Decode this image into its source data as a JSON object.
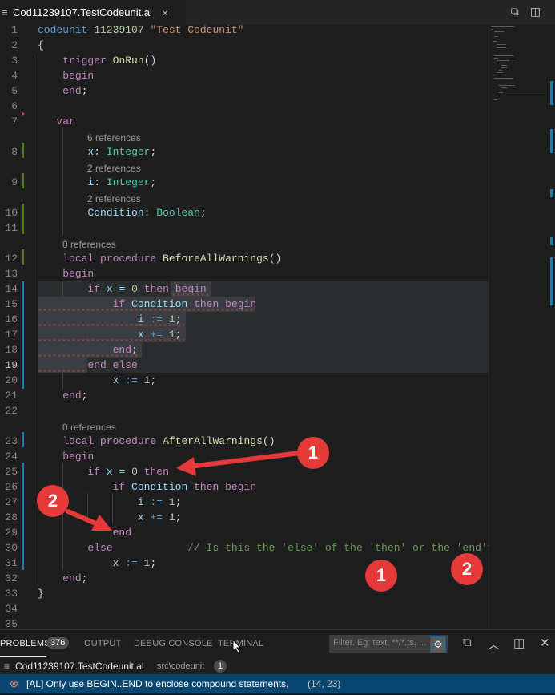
{
  "tab": {
    "icon": "≡",
    "title": "Cod11239107.TestCodeunit.al",
    "close": "×"
  },
  "tab_actions": {
    "compare": "⧉",
    "split": "◫"
  },
  "code": {
    "l1": {
      "n": "1",
      "a": "codeunit",
      "b": "11239107",
      "c": "\"Test Codeunit\""
    },
    "l2": {
      "n": "2",
      "a": "{"
    },
    "l3": {
      "n": "3",
      "a": "trigger",
      "b": "OnRun",
      "c": "()"
    },
    "l4": {
      "n": "4",
      "a": "begin"
    },
    "l5": {
      "n": "5",
      "a": "end",
      "b": ";"
    },
    "l6": {
      "n": "6"
    },
    "l7": {
      "n": "7",
      "a": "var"
    },
    "lens8": "6 references",
    "l8": {
      "n": "8",
      "a": "x",
      "b": ":",
      "c": "Integer",
      "d": ";"
    },
    "lens9": "2 references",
    "l9": {
      "n": "9",
      "a": "i",
      "b": ":",
      "c": "Integer",
      "d": ";"
    },
    "lens10": "2 references",
    "l10": {
      "n": "10",
      "a": "Condition",
      "b": ":",
      "c": "Boolean",
      "d": ";"
    },
    "l11": {
      "n": "11"
    },
    "lens12": "0 references",
    "l12": {
      "n": "12",
      "a": "local procedure",
      "b": "BeforeAllWarnings",
      "c": "()"
    },
    "l13": {
      "n": "13",
      "a": "begin"
    },
    "l14": {
      "n": "14",
      "a": "if",
      "b": "x = ",
      "c": "0",
      "d": "then",
      "e": "begin"
    },
    "l15": {
      "n": "15",
      "a": "if",
      "b": "Condition",
      "c": "then",
      "d": "begin"
    },
    "l16": {
      "n": "16",
      "a": "i",
      "b": ":=",
      "c": "1",
      "d": ";"
    },
    "l17": {
      "n": "17",
      "a": "x",
      "b": "+=",
      "c": "1",
      "d": ";"
    },
    "l18": {
      "n": "18",
      "a": "end",
      "b": ";"
    },
    "l19": {
      "n": "19",
      "a": "end",
      "b": "else"
    },
    "l20": {
      "n": "20",
      "a": "x",
      "b": ":=",
      "c": "1",
      "d": ";"
    },
    "l21": {
      "n": "21",
      "a": "end",
      "b": ";"
    },
    "l22": {
      "n": "22"
    },
    "lens23": "0 references",
    "l23": {
      "n": "23",
      "a": "local procedure",
      "b": "AfterAllWarnings",
      "c": "()"
    },
    "l24": {
      "n": "24",
      "a": "begin"
    },
    "l25": {
      "n": "25",
      "a": "if",
      "b": "x = ",
      "c": "0",
      "d": "then"
    },
    "l26": {
      "n": "26",
      "a": "if",
      "b": "Condition",
      "c": "then",
      "d": "begin"
    },
    "l27": {
      "n": "27",
      "a": "i",
      "b": ":=",
      "c": "1",
      "d": ";"
    },
    "l28": {
      "n": "28",
      "a": "x",
      "b": "+=",
      "c": "1",
      "d": ";"
    },
    "l29": {
      "n": "29",
      "a": "end"
    },
    "l30": {
      "n": "30",
      "a": "else",
      "b": "// Is this the 'else' of the 'then' or the 'end'?"
    },
    "l31": {
      "n": "31",
      "a": "x",
      "b": ":=",
      "c": "1",
      "d": ";"
    },
    "l32": {
      "n": "32",
      "a": "end",
      "b": ";"
    },
    "l33": {
      "n": "33",
      "a": "}"
    },
    "l34": {
      "n": "34"
    },
    "l35": {
      "n": "35"
    }
  },
  "panel": {
    "problems": "PROBLEMS",
    "problems_count": "376",
    "output": "OUTPUT",
    "debug_console": "DEBUG CONSOLE",
    "terminal": "TERMINAL",
    "filter_placeholder": "Filter. Eg: text, **/*.ts, ...",
    "filter_icon": "⚙",
    "collapse_icon": "⧉",
    "maximize_icon": "︿",
    "layout_icon": "◫",
    "close_icon": "✕"
  },
  "problems": {
    "file_icon": "≡",
    "file": "Cod11239107.TestCodeunit.al",
    "folder": "src\\codeunit",
    "count": "1",
    "error_icon": "⊗",
    "message": "[AL] Only use BEGIN..END to enclose compound statements.",
    "position": "(14, 23)"
  },
  "annotations": {
    "one": "1",
    "two": "2"
  },
  "colors": {
    "arrow": "#e5393a",
    "selection": "#3a3d41",
    "status_selected": "#094771"
  }
}
